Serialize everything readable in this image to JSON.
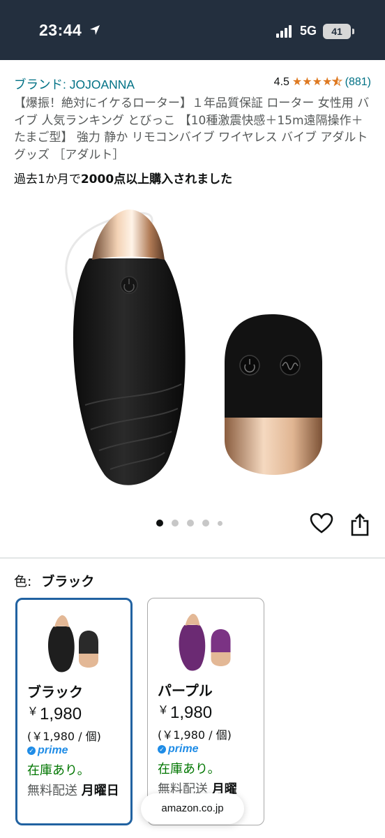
{
  "status_bar": {
    "time": "23:44",
    "network": "5G",
    "battery": "41"
  },
  "product": {
    "brand": "ブランド: JOJOANNA",
    "rating": "4.5",
    "review_count": "(881)",
    "title": "【爆振！絶対にイケるローター】１年品質保証 ローター 女性用 バイブ 人気ランキング とびっこ 【10種激震快感＋15m遠隔操作＋たまご型】 強力 静か リモコンバイブ ワイヤレス バイブ アダルトグッズ ［アダルト］",
    "bought_prefix": "過去1か月で",
    "bought_bold": "2000点以上購入されました",
    "image_count": 5,
    "active_image": 1
  },
  "color": {
    "label": "色:",
    "selected": "ブラック"
  },
  "variants": [
    {
      "name": "ブラック",
      "currency": "￥",
      "price": "1,980",
      "unit_price": "(￥1,980 / 個)",
      "prime": "prime",
      "stock": "在庫あり。",
      "shipping_prefix": "無料配送",
      "shipping_day": "月曜日",
      "body_color": "#1e1e1e"
    },
    {
      "name": "パープル",
      "currency": "￥",
      "price": "1,980",
      "unit_price": "(￥1,980 / 個)",
      "prime": "prime",
      "stock": "在庫あり。",
      "shipping_prefix": "無料配送",
      "shipping_day": "月曜",
      "body_color": "#6b2a73"
    }
  ],
  "browser": {
    "url": "amazon.co.jp"
  },
  "colors": {
    "header_bg": "#232f3e",
    "link": "#007185",
    "star": "#de7921",
    "stock_green": "#007600",
    "prime_blue": "#1f8ce6",
    "selected_border": "#2162a1"
  }
}
